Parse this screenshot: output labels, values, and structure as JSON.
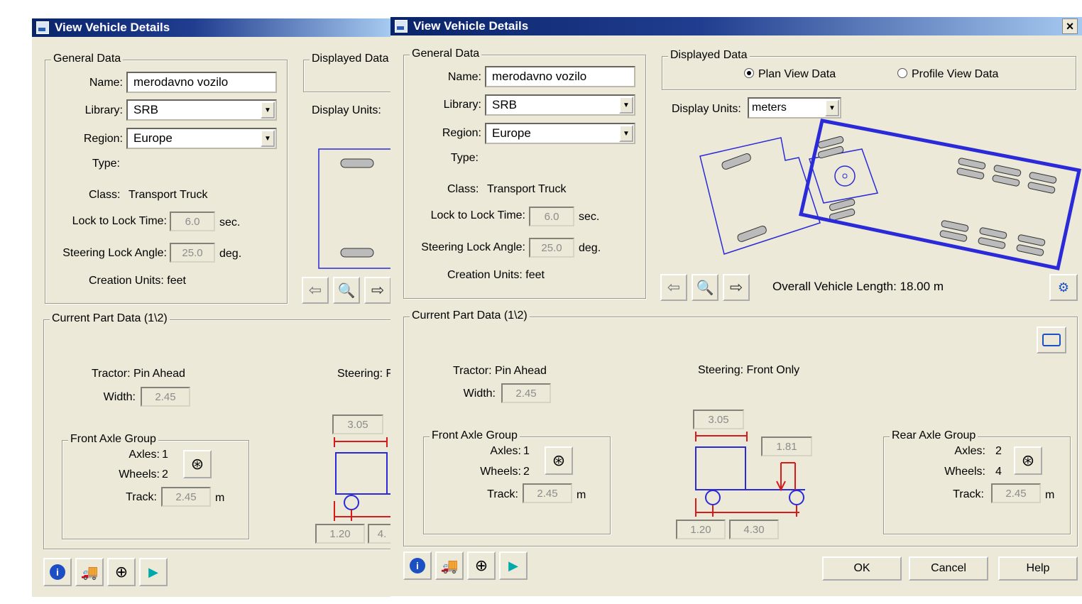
{
  "window": {
    "title": "View Vehicle Details",
    "close_label": "×"
  },
  "general": {
    "title": "General Data",
    "name_label": "Name:",
    "name_value": "merodavno vozilo",
    "library_label": "Library:",
    "library_value": "SRB",
    "region_label": "Region:",
    "region_value": "Europe",
    "type_label": "Type:",
    "class_label": "Class:",
    "class_value": "Transport Truck",
    "lock_label": "Lock to Lock Time:",
    "lock_value": "6.0",
    "lock_unit": "sec.",
    "steer_label": "Steering Lock Angle:",
    "steer_value": "25.0",
    "steer_unit": "deg.",
    "creation_label": "Creation Units: feet"
  },
  "displayed": {
    "title": "Displayed Data",
    "plan_label": "Plan View Data",
    "profile_label": "Profile View Data",
    "units_label": "Display Units:",
    "units_value": "meters",
    "overall_label": "Overall Vehicle Length: 18.00 m"
  },
  "part": {
    "title": "Current Part Data (1\\2)",
    "tractor_label": "Tractor: Pin Ahead",
    "width_label": "Width:",
    "width_value": "2.45",
    "steering_label": "Steering: Front Only",
    "steering_partial": "Steering: F",
    "front_group": "Front Axle Group",
    "rear_group": "Rear Axle Group",
    "axles_label": "Axles:",
    "front_axles": "1",
    "rear_axles": "2",
    "wheels_label": "Wheels:",
    "front_wheels": "2",
    "rear_wheels": "4",
    "track_label": "Track:",
    "track_value": "2.45",
    "track_unit": "m",
    "dim_top": "3.05",
    "dim_right": "1.81",
    "dim_bl": "1.20",
    "dim_br": "4.30",
    "dim_br_partial": "4."
  },
  "buttons": {
    "ok": "OK",
    "cancel": "Cancel",
    "help": "Help"
  },
  "icons": {
    "info": "info-icon",
    "truck": "truck-icon",
    "crosshair": "crosshair-icon",
    "vehicle_export": "vehicle-export-icon",
    "wheel": "wheel-icon",
    "zoom": "zoom-icon",
    "arrow_left": "arrow-left-icon",
    "arrow_right": "arrow-right-icon"
  },
  "colors": {
    "title_start": "#0a246a",
    "drawing_blue": "#2a2ad8",
    "dim_red": "#d81a1a",
    "dialog_bg": "#ece9d8"
  }
}
